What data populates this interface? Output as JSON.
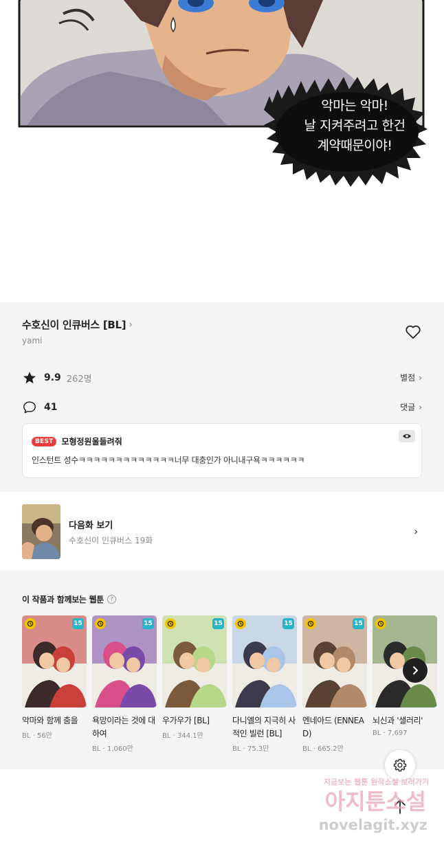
{
  "comic": {
    "speech_lines": [
      "악마는 악마!",
      "날 지켜주려고 한건",
      "계약때문이야!"
    ]
  },
  "series": {
    "title": "수호신이 인큐버스 [BL]",
    "author": "yami",
    "rating": "9.9",
    "rating_count": "262명",
    "rating_link": "별점",
    "comment_count": "41",
    "comment_link": "댓글"
  },
  "best_comment": {
    "badge": "BEST",
    "user": "모형정원울들려줘",
    "text": "인스턴트 성수ㅋㅋㅋㅋㅋㅋㅋㅋㅋㅋㅋㅋㅋ너무 대충인가 아니내구욕ㅋㅋㅋㅋㅋㅋ"
  },
  "next_episode": {
    "title": "다음화 보기",
    "subtitle": "수호신이 인큐버스 19화"
  },
  "recommendations": {
    "heading": "이 작품과 함께보는 웹툰",
    "items": [
      {
        "title": "악마와 함께 춤을",
        "meta": "BL · 56만",
        "age": "15",
        "colors": [
          "#c9403a",
          "#3a2a2a"
        ]
      },
      {
        "title": "욕망이라는 것에 대하여",
        "meta": "BL · 1,060만",
        "age": "15",
        "colors": [
          "#7a4aa8",
          "#d94f8a"
        ]
      },
      {
        "title": "우가우가 [BL]",
        "meta": "BL · 344.1만",
        "age": "15",
        "colors": [
          "#b7d88a",
          "#7a5a3a"
        ]
      },
      {
        "title": "다니엘의 지극히 사적인 빌런 [BL]",
        "meta": "BL · 75.3만",
        "age": "15",
        "colors": [
          "#a9c6e8",
          "#3a3a4a"
        ]
      },
      {
        "title": "엔네아드 (ENNEAD)",
        "meta": "BL · 665.2만",
        "age": "15",
        "colors": [
          "#b08a6a",
          "#5a4232"
        ]
      },
      {
        "title": "뇌신과 '샐러리'",
        "meta": "BL · 7,697",
        "age": "",
        "colors": [
          "#6a8a4a",
          "#2a2a2a"
        ]
      }
    ]
  },
  "watermark": {
    "line1": "지금보는 웹툰 원작소설 보러가기",
    "line2": "아지툰소설",
    "line3": "novelagit.xyz"
  }
}
